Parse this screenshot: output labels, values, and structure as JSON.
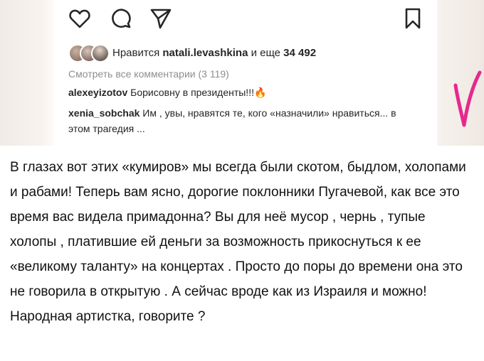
{
  "post": {
    "likes_prefix": "Нравится ",
    "likes_user": "natali.levashkina",
    "likes_middle": " и еще ",
    "likes_count": "34 492",
    "view_all_comments": "Смотреть все комментарии (3 119)",
    "comments": [
      {
        "user": "alexeyizotov",
        "text": " Борисовну в президенты!!!",
        "emoji": "🔥"
      },
      {
        "user": "xenia_sobchak",
        "text": " Им , увы, нравятся те, кого «назначили» нравиться... в этом трагедия ..."
      }
    ],
    "icons": [
      "heart-icon",
      "comment-icon",
      "share-icon",
      "bookmark-icon"
    ],
    "accent_color": "#e6298c"
  },
  "article": {
    "text": "В глазах вот этих «кумиров» мы всегда были скотом, быдлом, холопами и рабами! Теперь вам ясно, дорогие поклонники Пугачевой, как все это время вас видела примадонна? Вы для неё мусор , чернь , тупые холопы , платившие ей деньги за возможность прикоснуться к ее «великому таланту» на концертах . Просто до поры до времени она это не говорила в открытую . А сейчас вроде как из Израиля и можно! Народная артистка, говорите ?"
  }
}
